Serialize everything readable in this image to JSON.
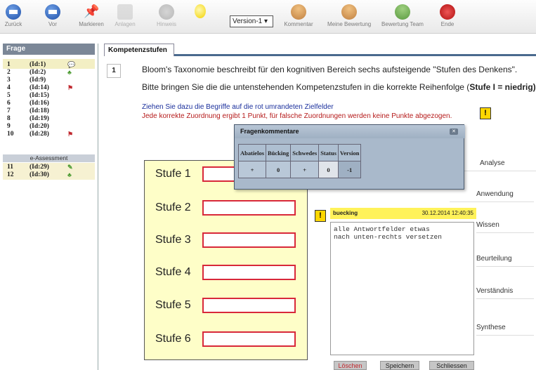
{
  "toolbar": {
    "back": "Zurück",
    "forward": "Vor",
    "mark": "Markieren",
    "attach": "Anlagen",
    "hints": "Hinweis",
    "version": "Version-1",
    "comment": "Kommentar",
    "my_rating": "Meine Bewertung",
    "team_rating": "Bewertung Team",
    "end": "Ende"
  },
  "left": {
    "header": "Frage",
    "questions": [
      {
        "num": "1",
        "id": "(Id:1)"
      },
      {
        "num": "2",
        "id": "(Id:2)"
      },
      {
        "num": "3",
        "id": "(Id:9)"
      },
      {
        "num": "4",
        "id": "(Id:14)"
      },
      {
        "num": "5",
        "id": "(Id:15)"
      },
      {
        "num": "6",
        "id": "(Id:16)"
      },
      {
        "num": "7",
        "id": "(Id:18)"
      },
      {
        "num": "8",
        "id": "(Id:19)"
      },
      {
        "num": "9",
        "id": "(Id:20)"
      },
      {
        "num": "10",
        "id": "(Id:28)"
      },
      {
        "num": "11",
        "id": "(Id:29)"
      },
      {
        "num": "12",
        "id": "(Id:30)"
      }
    ],
    "section": "e-Assessment"
  },
  "main": {
    "tab": "Kompetenzstufen",
    "qnum": "1",
    "line1": "Bloom's Taxonomie beschreibt für den kognitiven Bereich sechs aufsteigende \"Stufen des Denkens\".",
    "line2a": "Bitte bringen Sie die die untenstehenden Kompetenzstufen in die korrekte Reihenfolge (",
    "line2b": "Stufe I = niedrig",
    "line3": "Ziehen Sie dazu die Begriffe auf die rot umrandeten Zielfelder",
    "line4": "Jede korrekte Zuordnung ergibt 1 Punkt, für falsche Zuordnungen werden keine Punkte abgezogen.",
    "stufen": [
      "Stufe 1",
      "Stufe 2",
      "Stufe 3",
      "Stufe 4",
      "Stufe 5",
      "Stufe 6"
    ],
    "words": [
      "Analyse",
      "Anwendung",
      "Wissen",
      "Beurteilung",
      "Verständnis",
      "Synthese"
    ]
  },
  "dialog": {
    "title": "Fragenkommentare",
    "headers": [
      "Abatielos",
      "Bücking",
      "Schwedes",
      "Status",
      "Version"
    ],
    "values": [
      "+",
      "0",
      "+",
      "0",
      "-1"
    ]
  },
  "note": {
    "user": "buecking",
    "date": "30.12.2014 12:40:35",
    "text": "alle Antwortfelder etwas\nnach unten-rechts versetzen",
    "delete": "Löschen",
    "save": "Speichern",
    "close": "Schliessen"
  },
  "colors": {
    "accent": "#4a6a8e",
    "target_border": "#d8283a",
    "drop_bg": "#fefec8",
    "note_head": "#fff25a"
  }
}
